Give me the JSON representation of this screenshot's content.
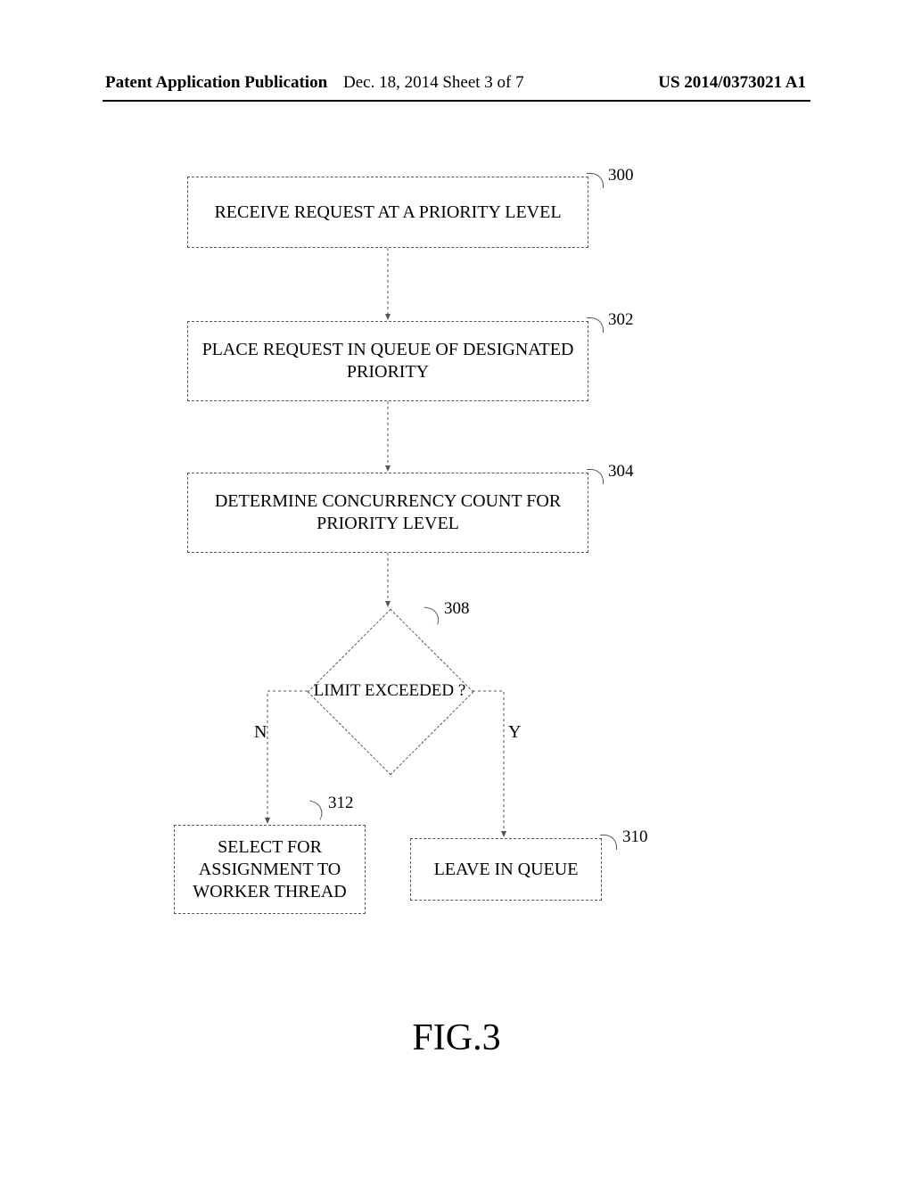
{
  "header": {
    "left": "Patent Application Publication",
    "middle": "Dec. 18, 2014  Sheet 3 of 7",
    "right": "US 2014/0373021 A1"
  },
  "nodes": {
    "n300": {
      "text": "RECEIVE REQUEST AT A PRIORITY LEVEL",
      "ref": "300"
    },
    "n302": {
      "text": "PLACE REQUEST IN QUEUE OF DESIGNATED PRIORITY",
      "ref": "302"
    },
    "n304": {
      "text": "DETERMINE CONCURRENCY COUNT FOR PRIORITY LEVEL",
      "ref": "304"
    },
    "n308": {
      "text": "LIMIT EXCEEDED ?",
      "ref": "308"
    },
    "n310": {
      "text": "LEAVE IN QUEUE",
      "ref": "310"
    },
    "n312": {
      "text": "SELECT FOR ASSIGNMENT TO WORKER THREAD",
      "ref": "312"
    }
  },
  "branches": {
    "no": "N",
    "yes": "Y"
  },
  "figure_caption": "FIG.3"
}
